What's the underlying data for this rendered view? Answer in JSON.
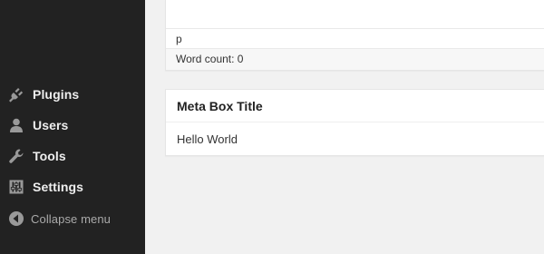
{
  "sidebar": {
    "items": [
      {
        "label": "Plugins",
        "icon": "plug-icon"
      },
      {
        "label": "Users",
        "icon": "user-icon"
      },
      {
        "label": "Tools",
        "icon": "wrench-icon"
      },
      {
        "label": "Settings",
        "icon": "sliders-icon"
      }
    ],
    "collapse_label": "Collapse menu"
  },
  "editor": {
    "path": "p",
    "word_count": "Word count: 0"
  },
  "meta_box": {
    "title": "Meta Box Title",
    "content": "Hello World"
  },
  "colors": {
    "sidebar_bg": "#222222",
    "page_bg": "#f1f1f1",
    "menu_text": "#eeeeee",
    "icon_color": "#999999"
  }
}
